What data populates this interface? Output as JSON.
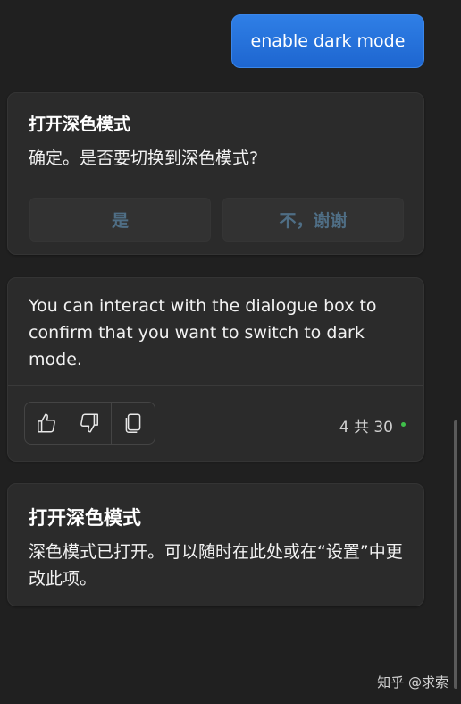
{
  "user_message": "enable dark mode",
  "dialog_card": {
    "title": "打开深色模式",
    "question": "确定。是否要切换到深色模式?",
    "yes_label": "是",
    "no_label": "不，谢谢"
  },
  "assistant_message": {
    "text": "You can interact with the dialogue box to confirm that you want to switch to dark mode.",
    "feedback_icons": [
      "thumbs-up-icon",
      "thumbs-down-icon",
      "copy-icon"
    ],
    "counter": "4 共 30",
    "status_color": "#3fbf4a"
  },
  "result_card": {
    "title": "打开深色模式",
    "body": "深色模式已打开。可以随时在此处或在“设置”中更改此项。"
  },
  "watermark": "知乎 @求索",
  "colors": {
    "background": "#202020",
    "card": "#2b2b2b",
    "accent_blue": "#1e66d0",
    "disabled_button_text": "#4f6e85"
  }
}
